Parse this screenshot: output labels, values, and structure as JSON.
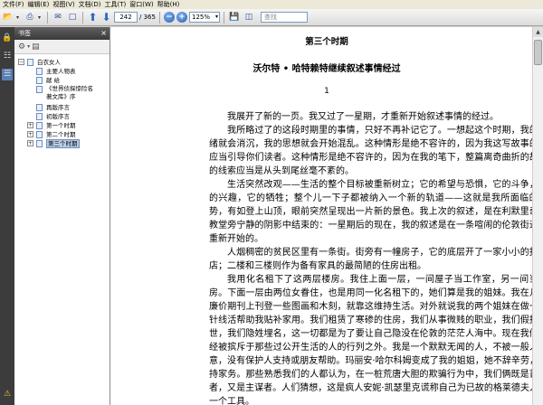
{
  "menu": [
    "文件(F)",
    "编辑(E)",
    "视图(V)",
    "文档(D)",
    "工具(T)",
    "窗口(W)",
    "帮助(H)"
  ],
  "toolbar": {
    "current_page": "242",
    "page_total": "/ 365",
    "zoom": "125%",
    "search_placeholder": "查找"
  },
  "panel": {
    "title": "书签",
    "close": "×"
  },
  "bookmarks": [
    {
      "label": "白衣女人",
      "level": 0,
      "toggle": "−"
    },
    {
      "label": "主要人物表",
      "level": 1
    },
    {
      "label": "献 给",
      "level": 1
    },
    {
      "label": "《世界侦探惊险名著文库》序",
      "level": 1
    },
    {
      "label": "再版序言",
      "level": 1
    },
    {
      "label": "初版序言",
      "level": 1
    },
    {
      "label": "第一个时期",
      "level": 1,
      "toggle": "+"
    },
    {
      "label": "第二个时期",
      "level": 1,
      "toggle": "+"
    },
    {
      "label": "第三个时期",
      "level": 1,
      "toggle": "+",
      "selected": true
    }
  ],
  "document": {
    "chapter": "第三个时期",
    "subtitle": "沃尔特 • 哈特赖特继续叙述事情经过",
    "page_number": "1",
    "paragraphs": [
      "我展开了新的一页。我又过了一星期，才重新开始叙述事情的经过。",
      "我所略过了的这段时期里的事情，只好不再补记它了。一想起这个时期，我的情绪就会消沉，我的思想就会开始混乱。这种情形是绝不容许的，因为我这写故事的人应当引导你们读者。这种情形是绝不容许的，因为在我的笔下，整篇离奇曲折的故事的线索应当是从头到尾丝毫不紊的。",
      "生活突然改观——生活的整个目标被重新树立；它的希望与恐惧，它的斗争，它的兴趣，它的牺牲；整个儿一下子都被纳入一个新的轨道——这就是我所面临的形势，有如登上山顶，眼前突然呈现出一片新的景色。我上次的叙述，是在利默里奇村教堂旁宁静的阴影中结束的：一星期后的现在，我的叙述是在一条喧闹的伦敦街道上重新开始的。",
      "人烟稠密的贫民区里有一条街。街旁有一幢房子，它的底层开了一家小小的报纸店；二楼和三楼则作为备有家具的最简陋的住房出租。",
      "我用化名租下了这两层楼房。我住上面一层，一间屋子当工作室，另一间当卧房。下面一层由两位女眷住，也是用同一化名租下的，她们算是我的姐妹。我在几份廉价期刊上刊登一些图画和木刻，就靠这维持生活。对外就说我的两个姐妹在做一些针线活帮助我贴补家用。我们租赁了寒碜的住房，我们从事微贱的职业，我们假报家世，我们隐姓埋名，这一切都是为了要让自己隐没在伦敦的茫茫人海中。现在我们已经被摈斥于那些过公开生活的人的行列之外。我是一个默默无闻的人，不被一般人注意，没有保护人支持或朋友帮助。玛丽安·哈尔科姆变成了我的姐姐，她不辞辛劳，操持家务。那些熟悉我们的人都认为，在一桩荒唐大胆的欺骗行为中，我们俩既是首从者，又是主谋者。人们猜想，这是疯人安妮·凯瑟里克谎称自己为已故的格莱德夫人的一个工具。"
    ]
  }
}
